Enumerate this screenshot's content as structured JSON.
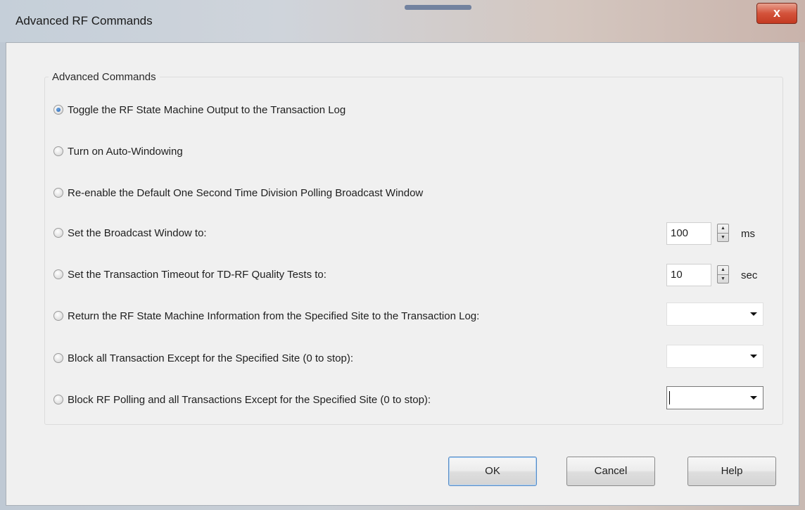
{
  "window": {
    "title": "Advanced RF Commands",
    "close_glyph": "x"
  },
  "group": {
    "title": "Advanced Commands"
  },
  "options": [
    {
      "label": "Toggle the RF State Machine Output to the Transaction Log",
      "selected": true
    },
    {
      "label": "Turn on Auto-Windowing",
      "selected": false
    },
    {
      "label": "Re-enable the Default One Second Time Division Polling Broadcast Window",
      "selected": false
    },
    {
      "label": "Set the Broadcast Window to:",
      "selected": false
    },
    {
      "label": "Set the Transaction Timeout for TD-RF Quality Tests to:",
      "selected": false
    },
    {
      "label": "Return the RF State Machine Information from the Specified Site to the Transaction Log:",
      "selected": false
    },
    {
      "label": "Block all Transaction Except for the Specified Site (0 to stop):",
      "selected": false
    },
    {
      "label": "Block RF Polling and all Transactions Except for the Specified Site (0 to stop):",
      "selected": false
    }
  ],
  "broadcast_window": {
    "value": "100",
    "unit": "ms"
  },
  "transaction_timeout": {
    "value": "10",
    "unit": "sec"
  },
  "site_combos": {
    "return_info": "",
    "block_transactions": "",
    "block_polling": ""
  },
  "buttons": {
    "ok": "OK",
    "cancel": "Cancel",
    "help": "Help"
  },
  "icons": {
    "close": "close-icon",
    "spin": "spin-arrows-icon",
    "dropdown": "chevron-down-icon"
  },
  "colors": {
    "close_button": "#c43a22",
    "selected_radio": "#1f5fb0",
    "dialog_background": "#f0f0f0"
  }
}
